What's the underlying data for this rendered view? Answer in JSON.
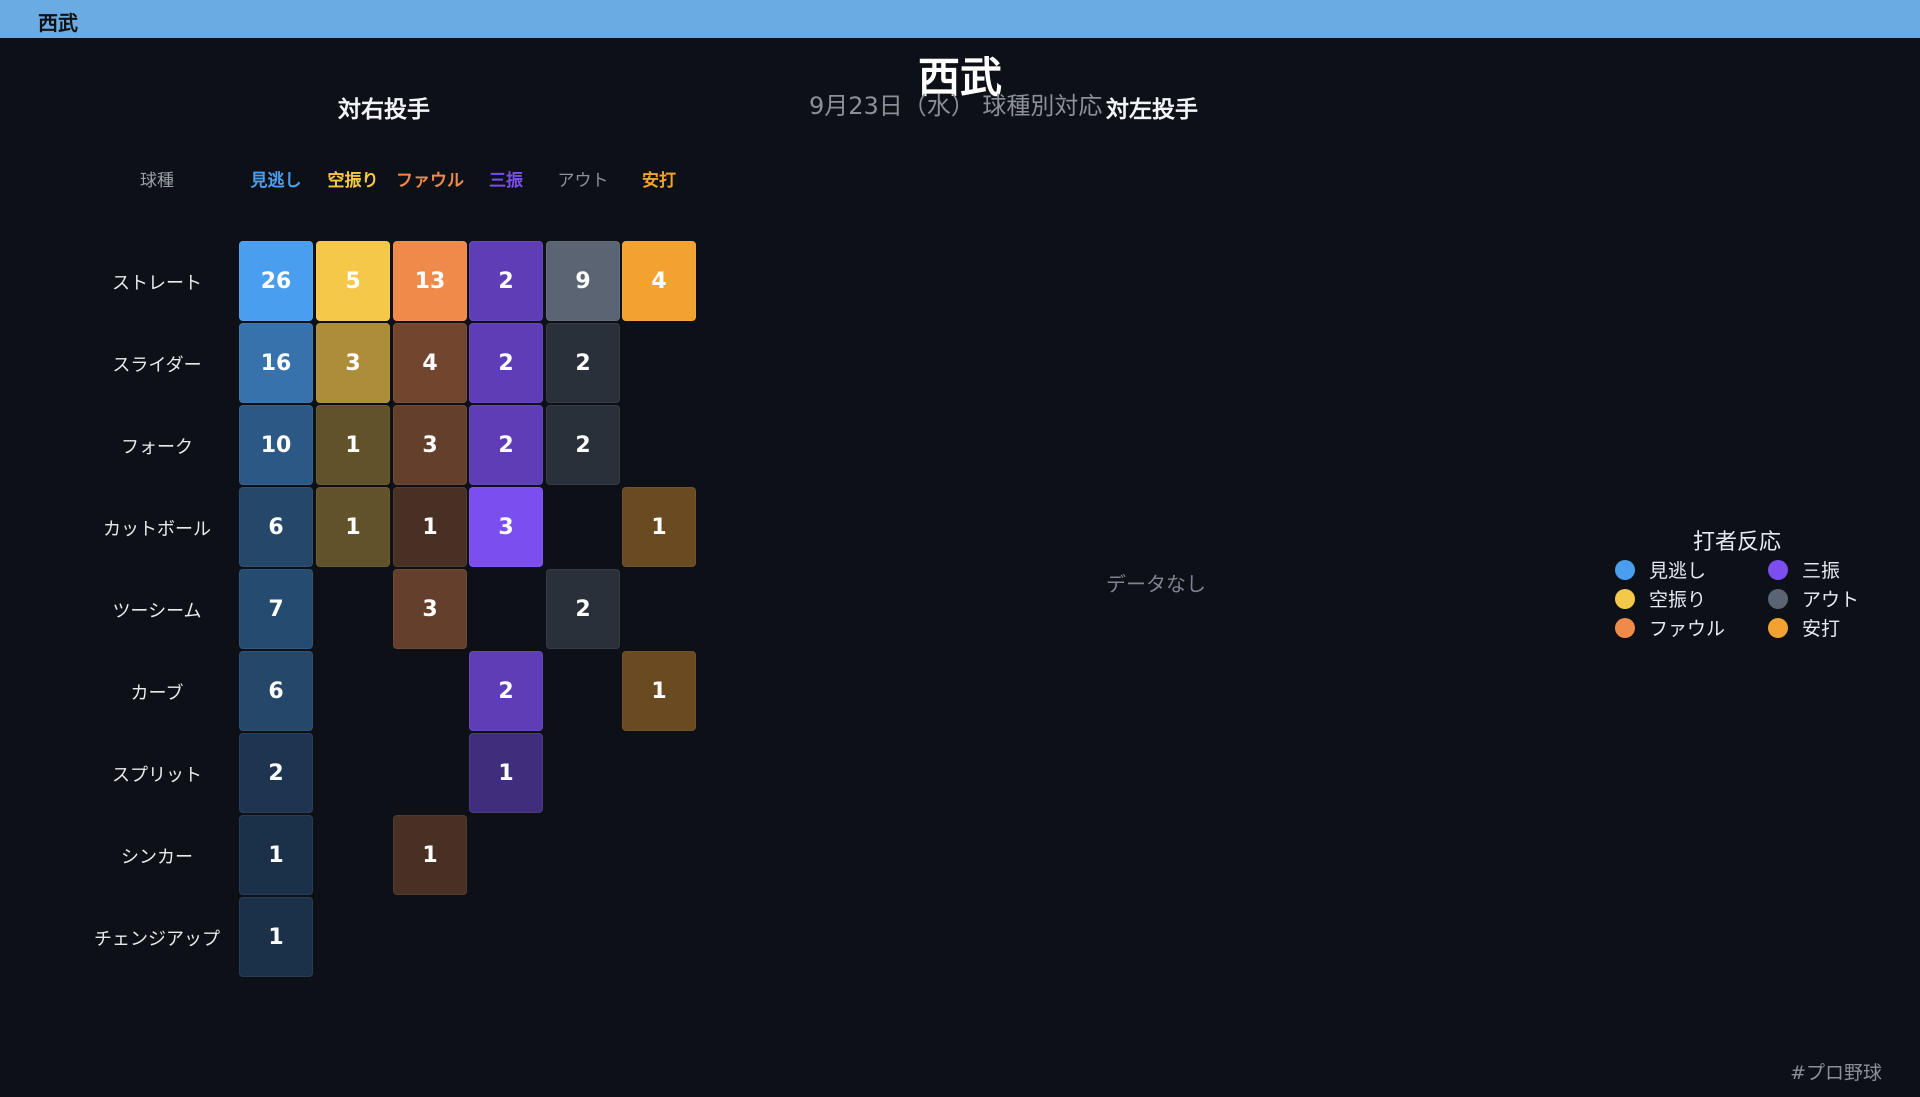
{
  "header": {
    "title": "西武"
  },
  "main": {
    "title": "西武",
    "subtitle": "9月23日（水） 球種別対応",
    "right_panel_title": "対右投手",
    "left_panel_title": "対左投手",
    "no_data": "データなし",
    "hashtag": "#プロ野球"
  },
  "legend": {
    "title": "打者反応",
    "items": [
      {
        "label": "見逃し",
        "color": "#4a9ef0"
      },
      {
        "label": "三振",
        "color": "#7b4ef0"
      },
      {
        "label": "空振り",
        "color": "#f5c84a"
      },
      {
        "label": "アウト",
        "color": "#5a6472"
      },
      {
        "label": "ファウル",
        "color": "#f08a4a"
      },
      {
        "label": "安打",
        "color": "#f2a230"
      }
    ]
  },
  "chart_data": {
    "type": "heatmap",
    "title": "対右投手",
    "row_header": "球種",
    "columns": [
      {
        "label": "見逃し",
        "color": "#4a9ef0"
      },
      {
        "label": "空振り",
        "color": "#f5c84a"
      },
      {
        "label": "ファウル",
        "color": "#f08a4a"
      },
      {
        "label": "三振",
        "color": "#7b4ef0"
      },
      {
        "label": "アウト",
        "color": "#5a6472"
      },
      {
        "label": "安打",
        "color": "#f2a230"
      }
    ],
    "rows": [
      {
        "label": "ストレート",
        "values": [
          26,
          5,
          13,
          2,
          9,
          4
        ]
      },
      {
        "label": "スライダー",
        "values": [
          16,
          3,
          4,
          2,
          2,
          null
        ]
      },
      {
        "label": "フォーク",
        "values": [
          10,
          1,
          3,
          2,
          2,
          null
        ]
      },
      {
        "label": "カットボール",
        "values": [
          6,
          1,
          1,
          3,
          null,
          1
        ]
      },
      {
        "label": "ツーシーム",
        "values": [
          7,
          null,
          3,
          null,
          2,
          null
        ]
      },
      {
        "label": "カーブ",
        "values": [
          6,
          null,
          null,
          2,
          null,
          1
        ]
      },
      {
        "label": "スプリット",
        "values": [
          2,
          null,
          null,
          1,
          null,
          null
        ]
      },
      {
        "label": "シンカー",
        "values": [
          1,
          null,
          1,
          null,
          null,
          null
        ]
      },
      {
        "label": "チェンジアップ",
        "values": [
          1,
          null,
          null,
          null,
          null,
          null
        ]
      }
    ]
  }
}
